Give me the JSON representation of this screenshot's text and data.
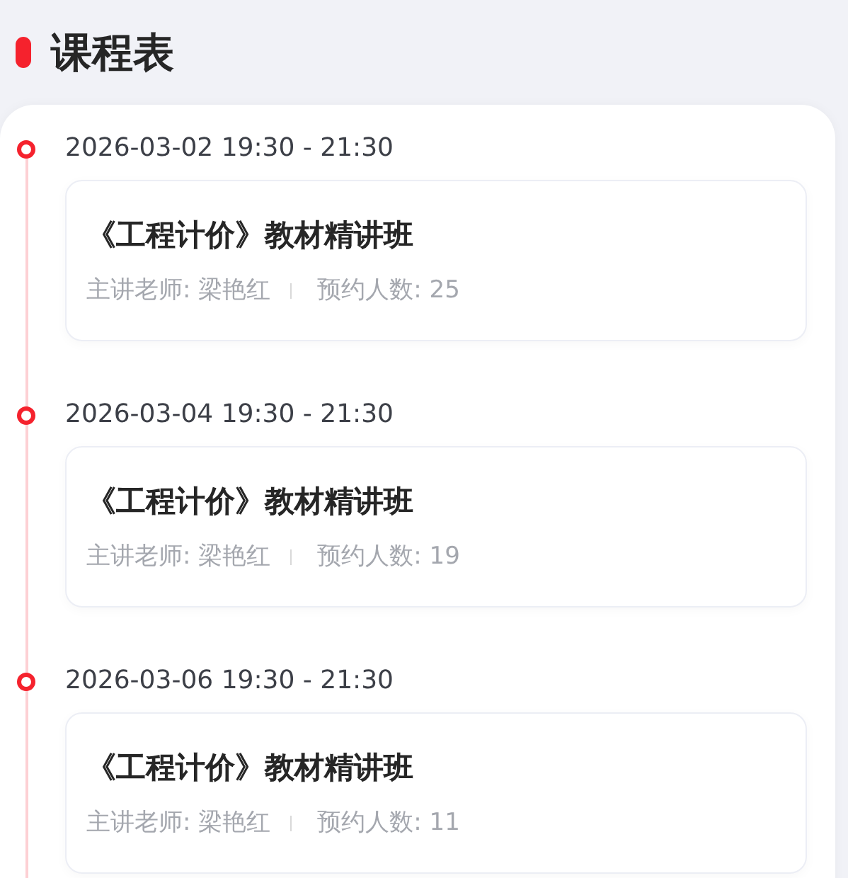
{
  "header": {
    "title": "课程表"
  },
  "lessons": [
    {
      "time": "2026-03-02 19:30 - 21:30",
      "title": "《工程计价》教材精讲班",
      "teacher": "主讲老师: 梁艳红",
      "bookings": "预约人数: 25"
    },
    {
      "time": "2026-03-04 19:30 - 21:30",
      "title": "《工程计价》教材精讲班",
      "teacher": "主讲老师: 梁艳红",
      "bookings": "预约人数: 19"
    },
    {
      "time": "2026-03-06 19:30 - 21:30",
      "title": "《工程计价》教材精讲班",
      "teacher": "主讲老师: 梁艳红",
      "bookings": "预约人数: 11"
    }
  ]
}
